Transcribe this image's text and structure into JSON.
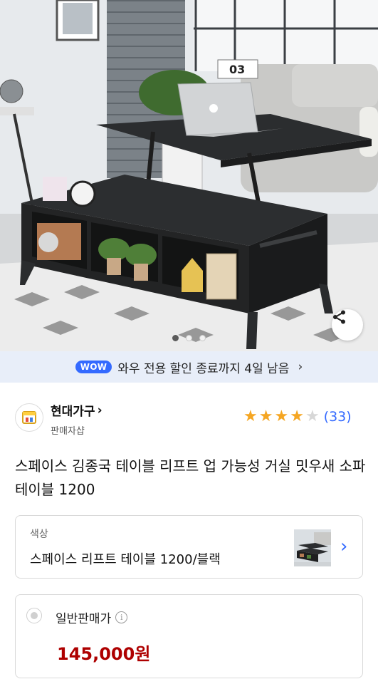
{
  "hero": {
    "calendar_text": "03",
    "carousel_dots": [
      true,
      false,
      false
    ]
  },
  "wow_banner": {
    "badge": "WOW",
    "text": "와우 전용 할인 종료까지 4일 남음",
    "chevron": "›"
  },
  "seller": {
    "name": "현대가구",
    "chevron": "›",
    "subtitle": "판매자샵",
    "rating_stars": 4,
    "rating_max": 5,
    "review_count": "(33)"
  },
  "product": {
    "title": "스페이스 김종국 테이블 리프트 업 가능성 거실 밋우새 소파 테이블 1200"
  },
  "option": {
    "label": "색상",
    "value": "스페이스 리프트 테이블 1200/블랙",
    "chevron": "›"
  },
  "price": {
    "label": "일반판매가",
    "info_glyph": "i",
    "value": "145,000원"
  },
  "colors": {
    "accent": "#346aff",
    "price": "#ae0000",
    "star": "#f5a623",
    "banner_bg": "#e8eef9"
  }
}
